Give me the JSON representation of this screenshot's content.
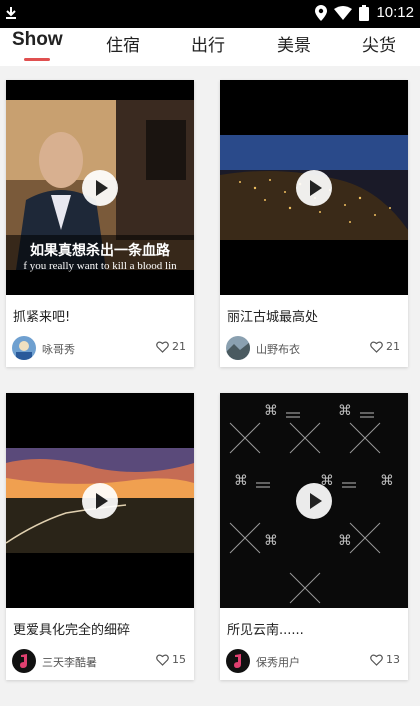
{
  "status": {
    "time": "10:12"
  },
  "tabs": [
    "Show",
    "住宿",
    "出行",
    "美景",
    "尖货"
  ],
  "cards": [
    {
      "title": "抓紧来吧!",
      "user": "咏哥秀",
      "likes": "21",
      "subtitle_cn": "如果真想杀出一条血路",
      "subtitle_en": "f you really want to kill a blood lin"
    },
    {
      "title": "丽江古城最高处",
      "user": "山野布衣",
      "likes": "21"
    },
    {
      "title": "更爱具化完全的细碎",
      "user": "三天李酷暑",
      "likes": "15"
    },
    {
      "title": "所见云南......",
      "user": "保秀用户",
      "likes": "13"
    }
  ],
  "colors": {
    "accent": "#e05050"
  },
  "icons": {
    "play": "play-icon",
    "like": "heart-icon",
    "download": "download-icon",
    "location": "location-icon",
    "wifi": "wifi-icon",
    "battery": "battery-icon"
  }
}
